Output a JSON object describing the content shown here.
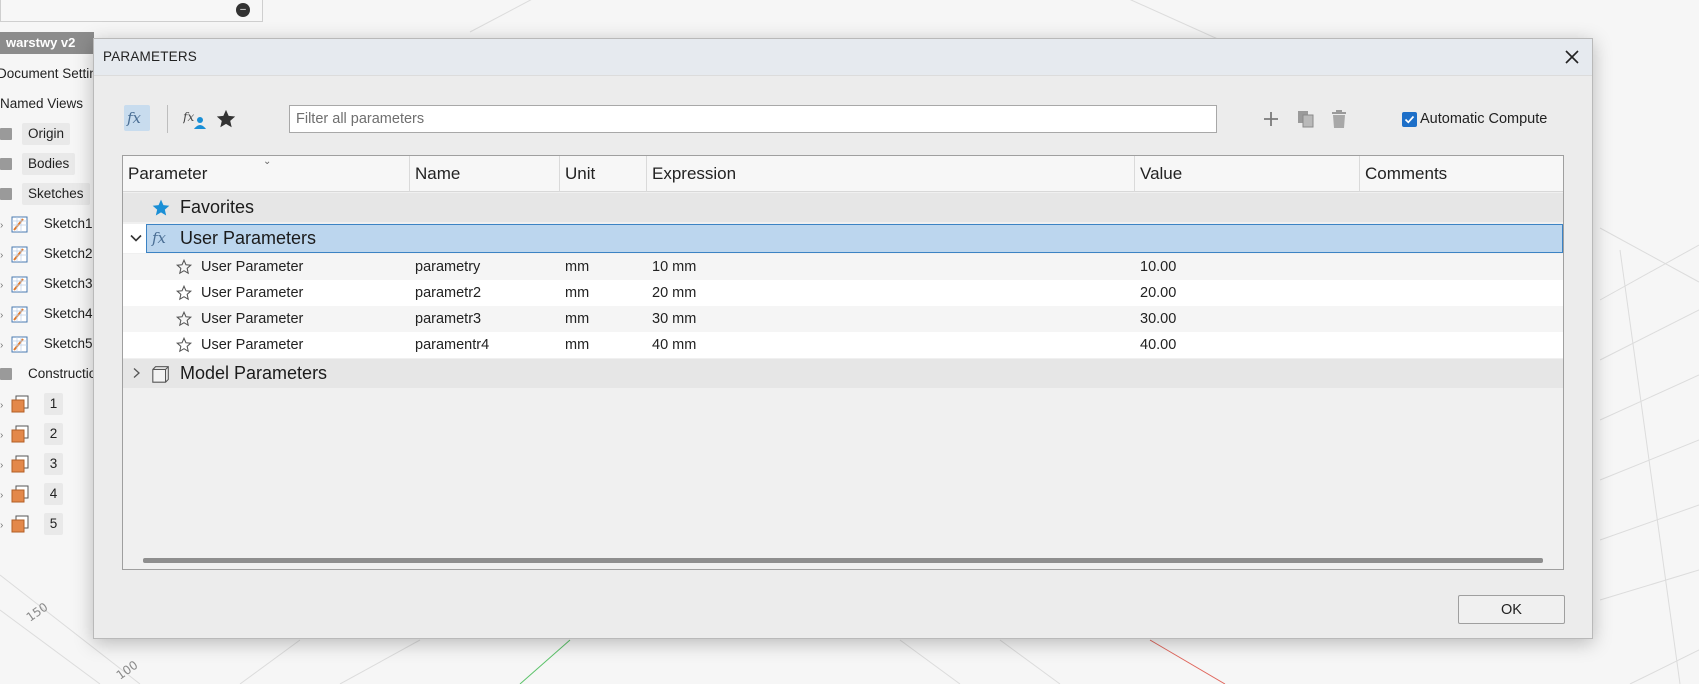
{
  "viewport": {
    "axis_labels": [
      "150",
      "100"
    ],
    "colors": {
      "grid": "#d9d9d9",
      "x_axis": "#e0665c",
      "y_axis": "#5cc36a"
    }
  },
  "browser": {
    "title": "warstwy v2",
    "items": [
      {
        "label": "Document Settings",
        "icon": "gear-icon"
      },
      {
        "label": "Named Views",
        "icon": "folder-icon"
      },
      {
        "label": "Origin",
        "icon": "folder-icon"
      },
      {
        "label": "Bodies",
        "icon": "folder-icon"
      },
      {
        "label": "Sketches",
        "icon": "folder-icon"
      },
      {
        "label": "Sketch1",
        "icon": "sketch-icon"
      },
      {
        "label": "Sketch2",
        "icon": "sketch-icon"
      },
      {
        "label": "Sketch3",
        "icon": "sketch-icon"
      },
      {
        "label": "Sketch4",
        "icon": "sketch-icon"
      },
      {
        "label": "Sketch5",
        "icon": "sketch-icon"
      },
      {
        "label": "Construction",
        "icon": "folder-icon"
      },
      {
        "label": "1",
        "icon": "component-icon"
      },
      {
        "label": "2",
        "icon": "component-icon"
      },
      {
        "label": "3",
        "icon": "component-icon"
      },
      {
        "label": "4",
        "icon": "component-icon"
      },
      {
        "label": "5",
        "icon": "component-icon"
      }
    ]
  },
  "dialog": {
    "title": "PARAMETERS",
    "toolbar": {
      "filter_placeholder": "Filter all parameters",
      "auto_compute_label": "Automatic Compute",
      "auto_compute_checked": true
    },
    "columns": [
      "Parameter",
      "Name",
      "Unit",
      "Expression",
      "Value",
      "Comments"
    ],
    "groups": {
      "favorites": "Favorites",
      "user": "User Parameters",
      "model": "Model Parameters"
    },
    "user_parameters": [
      {
        "type": "User Parameter",
        "name": "parametry",
        "unit": "mm",
        "expression": "10 mm",
        "value": "10.00",
        "comment": ""
      },
      {
        "type": "User Parameter",
        "name": "parametr2",
        "unit": "mm",
        "expression": "20 mm",
        "value": "20.00",
        "comment": ""
      },
      {
        "type": "User Parameter",
        "name": "parametr3",
        "unit": "mm",
        "expression": "30 mm",
        "value": "30.00",
        "comment": ""
      },
      {
        "type": "User Parameter",
        "name": "paramentr4",
        "unit": "mm",
        "expression": "40 mm",
        "value": "40.00",
        "comment": ""
      }
    ],
    "ok_label": "OK",
    "colors": {
      "selection": "#bcd6ee",
      "accent": "#1d6fc8",
      "favorite_star": "#1a8fd6"
    }
  }
}
